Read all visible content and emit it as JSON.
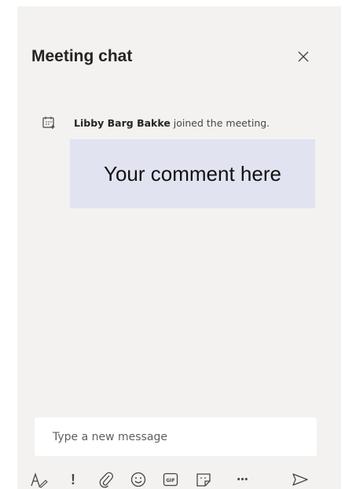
{
  "chat": {
    "title": "Meeting chat",
    "close_label": "×"
  },
  "system_message": {
    "name": "Libby Barg Bakke",
    "text": " joined the meeting."
  },
  "callout": {
    "text": "Your comment here"
  },
  "compose": {
    "placeholder": "Type a new message",
    "value": ""
  },
  "toolbar": {
    "icons": [
      "format-icon",
      "important-icon",
      "attach-icon",
      "emoji-icon",
      "gif-icon",
      "sticker-icon",
      "more-icon",
      "send-icon"
    ],
    "important_label": "!",
    "more_label": "•••"
  },
  "colors": {
    "panel_bg": "#f3f2f1",
    "callout_bg": "#e2e3f1",
    "text_dark": "#252423",
    "icon": "#484644"
  }
}
